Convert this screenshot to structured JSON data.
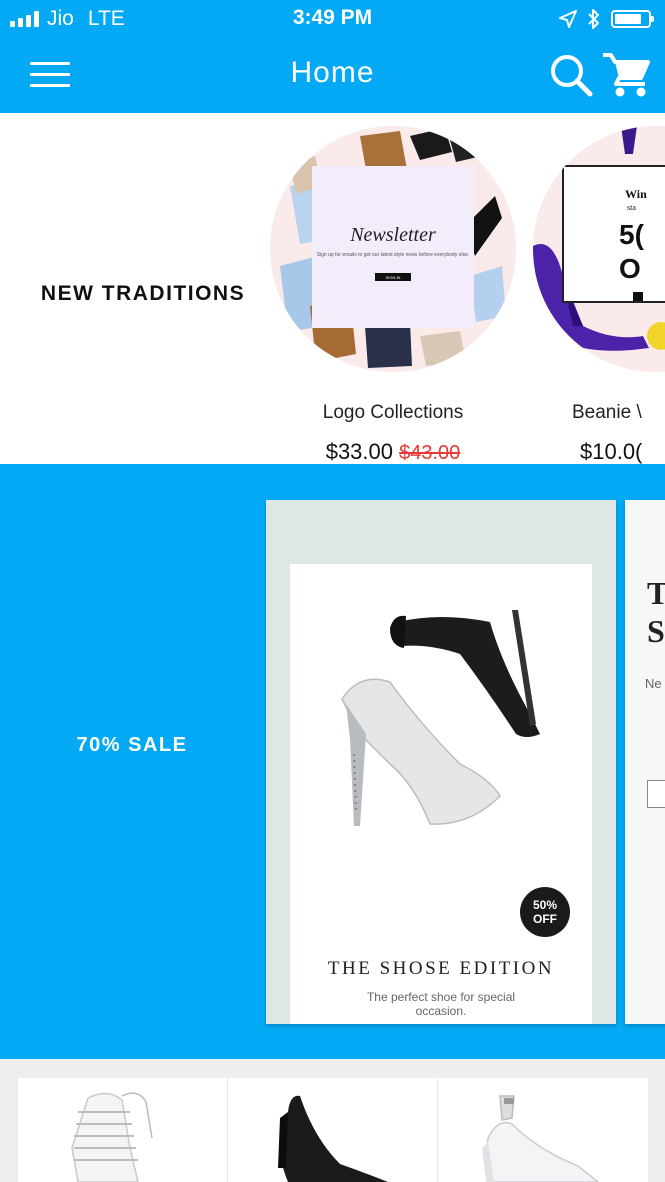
{
  "status_bar": {
    "carrier": "Jio",
    "network": "LTE",
    "time": "3:49 PM"
  },
  "nav": {
    "title": "Home",
    "menu_icon": "hamburger-menu-icon",
    "search_icon": "search-icon",
    "cart_icon": "cart-icon"
  },
  "section1": {
    "title": "NEW TRADITIONS",
    "products": [
      {
        "name": "Logo Collections",
        "price": "$33.00",
        "old_price": "$43.00",
        "image": {
          "title": "Newsletter",
          "text": "Sign up for emails to get our latest style news before everybody else.",
          "button": "SIGN IN"
        }
      },
      {
        "name": "Beanie \\",
        "price": "$10.0(",
        "image": {
          "line1": "Win",
          "line2": "sta",
          "big1": "5(",
          "big2": "O"
        }
      }
    ]
  },
  "section2": {
    "title": "70% SALE",
    "banners": [
      {
        "badge_top": "50%",
        "badge_bottom": "OFF",
        "headline": "THE SHOSE EDITION",
        "subtext": "The perfect shoe for special occasion."
      },
      {
        "headline_line1": "T",
        "headline_line2": "S",
        "text": "Ne"
      }
    ]
  },
  "section3": {
    "items": [
      "white-lace-up-heel",
      "black-pump",
      "white-slingback-heel"
    ]
  },
  "colors": {
    "primary": "#03a9f4",
    "sale_price": "#e53935",
    "text": "#111111"
  }
}
